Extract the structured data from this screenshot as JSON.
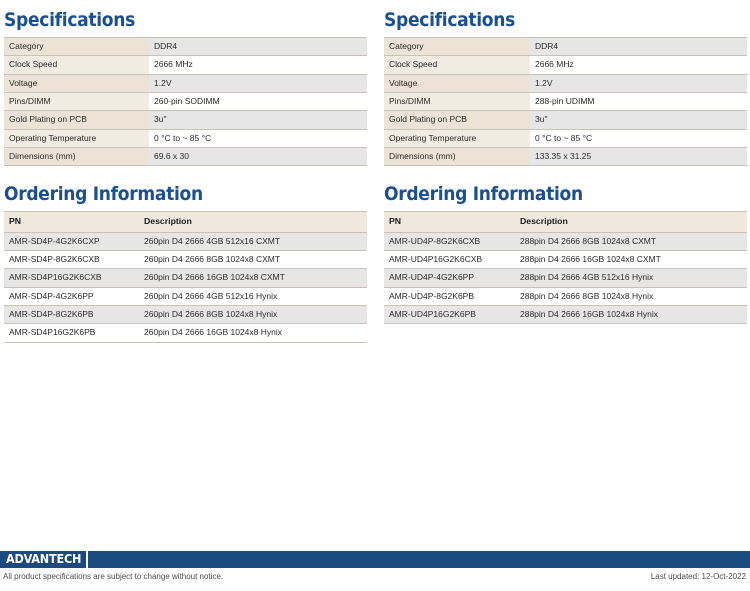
{
  "columns": [
    {
      "id": "sodimm",
      "specifications": {
        "title": "Specifications",
        "rows": [
          {
            "label": "Category",
            "value": "DDR4"
          },
          {
            "label": "Clock Speed",
            "value": "2666 MHz"
          },
          {
            "label": "Voltage",
            "value": "1.2V"
          },
          {
            "label": "Pins/DIMM",
            "value": "260-pin SODIMM"
          },
          {
            "label": "Gold Plating on PCB",
            "value": "3u\""
          },
          {
            "label": "Operating Temperature",
            "value": "0 °C to ~ 85 °C"
          },
          {
            "label": "Dimensions (mm)",
            "value": "69.6 x 30"
          }
        ]
      },
      "ordering": {
        "title": "Ordering Information",
        "headers": [
          "PN",
          "Description"
        ],
        "rows": [
          {
            "pn": "AMR-SD4P-4G2K6CXP",
            "description": "260pin D4 2666 4GB  512x16 CXMT"
          },
          {
            "pn": "AMR-SD4P-8G2K6CXB",
            "description": "260pin D4 2666 8GB 1024x8 CXMT"
          },
          {
            "pn": "AMR-SD4P16G2K6CXB",
            "description": "260pin D4 2666 16GB 1024x8 CXMT"
          },
          {
            "pn": "AMR-SD4P-4G2K6PP",
            "description": "260pin D4 2666 4GB 512x16 Hynix"
          },
          {
            "pn": "AMR-SD4P-8G2K6PB",
            "description": "260pin D4 2666 8GB 1024x8 Hynix"
          },
          {
            "pn": "AMR-SD4P16G2K6PB",
            "description": "260pin D4 2666 16GB 1024x8 Hynix"
          }
        ]
      }
    },
    {
      "id": "udimm",
      "specifications": {
        "title": "Specifications",
        "rows": [
          {
            "label": "Category",
            "value": "DDR4"
          },
          {
            "label": "Clock Speed",
            "value": "2666 MHz"
          },
          {
            "label": "Voltage",
            "value": "1.2V"
          },
          {
            "label": "Pins/DIMM",
            "value": "288-pin UDIMM"
          },
          {
            "label": "Gold Plating on PCB",
            "value": "3u\""
          },
          {
            "label": "Operating Temperature",
            "value": "0 °C to ~ 85 °C"
          },
          {
            "label": "Dimensions (mm)",
            "value": "133.35 x 31.25"
          }
        ]
      },
      "ordering": {
        "title": "Ordering Information",
        "headers": [
          "PN",
          "Description"
        ],
        "rows": [
          {
            "pn": "AMR-UD4P-8G2K6CXB",
            "description": "288pin D4 2666 8GB 1024x8 CXMT"
          },
          {
            "pn": "AMR-UD4P16G2K6CXB",
            "description": "288pin D4 2666 16GB 1024x8 CXMT"
          },
          {
            "pn": "AMR-UD4P-4G2K6PP",
            "description": "288pin D4 2666 4GB 512x16 Hynix"
          },
          {
            "pn": "AMR-UD4P-8G2K6PB",
            "description": "288pin D4 2666 8GB 1024x8 Hynix"
          },
          {
            "pn": "AMR-UD4P16G2K6PB",
            "description": "288pin D4 2666 16GB 1024x8 Hynix"
          }
        ]
      }
    }
  ],
  "footer": {
    "logo": "ADVANTECH",
    "disclaimer": "All product specifications are subject to change without notice.",
    "last_updated": "Last updated: 12-Oct-2022"
  },
  "colors": {
    "heading_blue": "#1a4f90",
    "footer_blue": "#1c4a7e",
    "label_beige": "#ece2d6",
    "row_gray": "#e6e6e6"
  }
}
